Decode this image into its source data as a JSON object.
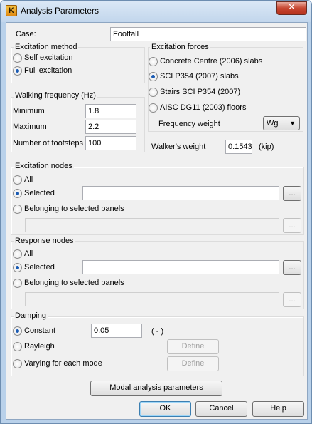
{
  "window": {
    "title": "Analysis Parameters",
    "app_icon_glyph": "K",
    "close_glyph": "✕"
  },
  "case": {
    "label": "Case:",
    "value": "Footfall"
  },
  "excitation_method": {
    "title": "Excitation method",
    "options": [
      "Self excitation",
      "Full excitation"
    ],
    "selected": "Full excitation"
  },
  "walking_frequency": {
    "title": "Walking frequency (Hz)",
    "minimum_label": "Minimum",
    "minimum_value": "1.8",
    "maximum_label": "Maximum",
    "maximum_value": "2.2",
    "footsteps_label": "Number of footsteps",
    "footsteps_value": "100"
  },
  "excitation_forces": {
    "title": "Excitation forces",
    "options": [
      "Concrete Centre (2006) slabs",
      "SCI P354 (2007) slabs",
      "Stairs SCI P354 (2007)",
      "AISC DG11 (2003) floors"
    ],
    "selected": "SCI P354 (2007) slabs",
    "frequency_weight_label": "Frequency weight",
    "frequency_weight_value": "Wg"
  },
  "walkers_weight": {
    "label": "Walker's weight",
    "value": "0.1543",
    "unit": "(kip)"
  },
  "excitation_nodes": {
    "title": "Excitation nodes",
    "all": "All",
    "selected": "Selected",
    "belonging": "Belonging to selected panels",
    "current": "Selected",
    "selected_value": "",
    "belonging_value": "",
    "browse_label": "..."
  },
  "response_nodes": {
    "title": "Response nodes",
    "all": "All",
    "selected": "Selected",
    "belonging": "Belonging to selected panels",
    "current": "Selected",
    "selected_value": "",
    "belonging_value": "",
    "browse_label": "..."
  },
  "damping": {
    "title": "Damping",
    "constant": "Constant",
    "constant_value": "0.05",
    "constant_unit": "( - )",
    "rayleigh": "Rayleigh",
    "varying": "Varying for each mode",
    "define_label": "Define",
    "current": "Constant"
  },
  "buttons": {
    "modal": "Modal analysis parameters",
    "ok": "OK",
    "cancel": "Cancel",
    "help": "Help"
  }
}
